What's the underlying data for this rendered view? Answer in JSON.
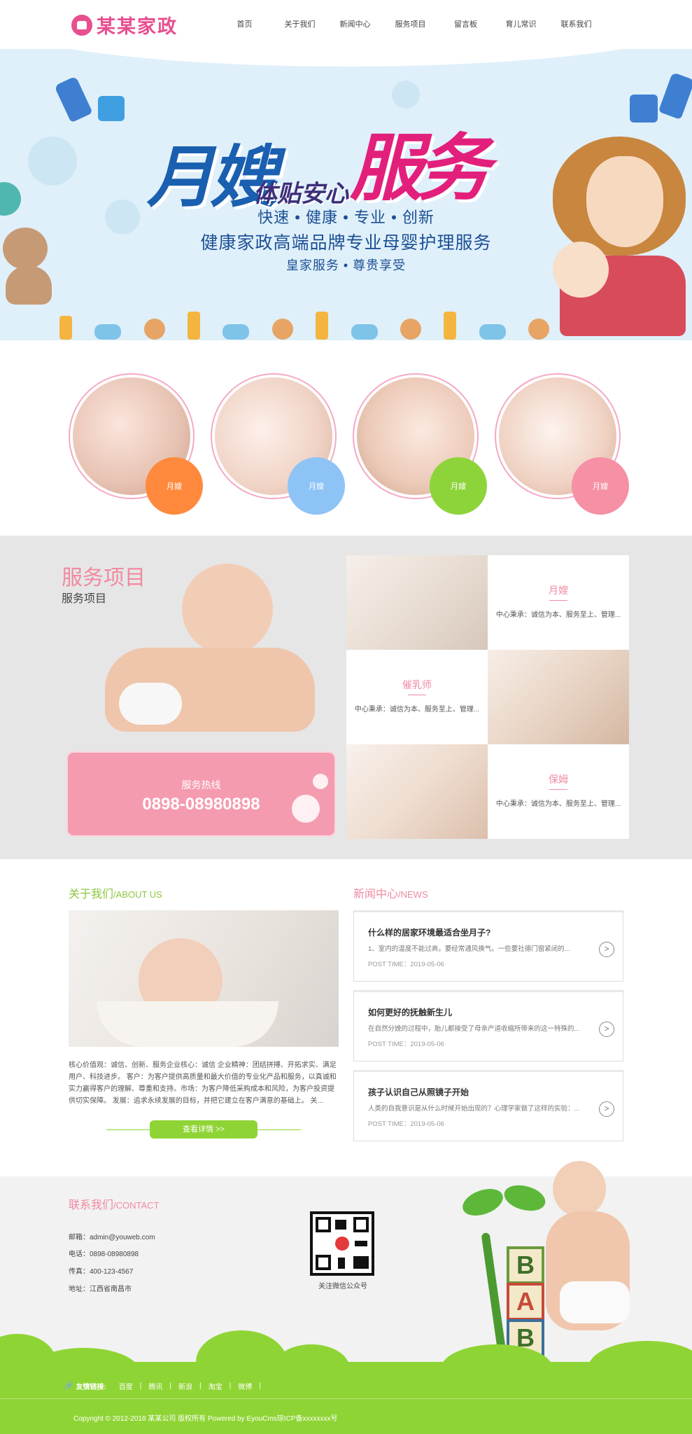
{
  "header": {
    "logo_text": "某某家政",
    "nav": [
      "首页",
      "关于我们",
      "新闻中心",
      "服务项目",
      "留言板",
      "育儿常识",
      "联系我们"
    ]
  },
  "banner": {
    "title_a": "月嫂",
    "title_b": "服务",
    "title_c": "体贴安心",
    "line1": "快速 • 健康 • 专业 • 创新",
    "line2": "健康家政高端品牌专业母婴护理服务",
    "line3": "皇家服务 • 尊贵享受"
  },
  "circles": [
    {
      "label": "月嫂",
      "color": "#ff8a3d"
    },
    {
      "label": "月嫂",
      "color": "#8ec3f5"
    },
    {
      "label": "月嫂",
      "color": "#8dd43a"
    },
    {
      "label": "月嫂",
      "color": "#f590a5"
    }
  ],
  "services": {
    "title": "服务项目",
    "subtitle": "服务项目",
    "hotline_label": "服务热线",
    "hotline_number": "0898-08980898",
    "items": [
      {
        "title": "月嫂",
        "desc": "中心秉承：诚信为本、服务至上、管理..."
      },
      {
        "title": "催乳师",
        "desc": "中心秉承：诚信为本、服务至上、管理..."
      },
      {
        "title": "保姆",
        "desc": "中心秉承：诚信为本、服务至上、管理..."
      }
    ]
  },
  "about": {
    "title": "关于我们",
    "title_en": "/ABOUT US",
    "text": "核心价值观：诚信、创新、服务企业核心：诚信 企业精神：团结拼搏、开拓求实、满足用户、科技进步。 客户：为客户提供高质量和最大价值的专业化产品和服务，以真诚和实力赢得客户的理解、尊重和支持。市场：为客户降低采购成本和风险，为客户投资提供切实保障。 发展：追求永续发展的目标，并把它建立在客户满意的基础上。 关...",
    "more": "查看详情 >>"
  },
  "news": {
    "title": "新闻中心",
    "title_en": "/NEWS",
    "items": [
      {
        "title": "什么样的居家环境最适合坐月子?",
        "desc": "1、室内的温度不能过高，要经常通风换气。一些要社德门窗紧闭的...",
        "time": "POST TIME：2019-05-06"
      },
      {
        "title": "如何更好的抚触新生儿",
        "desc": "在自然分娩的过程中，胎儿都接受了母亲产道收缩所带来的这一特殊的...",
        "time": "POST TIME：2019-05-06"
      },
      {
        "title": "孩子认识自己从照镜子开始",
        "desc": "人类的自我意识是从什么时候开始出现的？心理学家做了这样的实验：...",
        "time": "POST TIME：2019-05-06"
      }
    ]
  },
  "contact": {
    "title": "联系我们",
    "title_en": "/CONTACT",
    "email": "邮箱：admin@youweb.com",
    "phone": "电话：0898-08980898",
    "fax": "传真：400-123-4567",
    "address": "地址：江西省南昌市",
    "qr_caption": "关注微信公众号",
    "blocks": [
      "B",
      "A",
      "B"
    ]
  },
  "footer": {
    "links_label": "友情链接:",
    "links": [
      "百度",
      "腾讯",
      "新浪",
      "淘宝",
      "微博"
    ],
    "copyright": "Copyright © 2012-2018 某某公司 版权所有 Powered by EyouCms琼ICP备xxxxxxxx号"
  },
  "colors": {
    "pink": "#f08aa0",
    "green": "#8fd435",
    "navy": "#1c4f94"
  }
}
